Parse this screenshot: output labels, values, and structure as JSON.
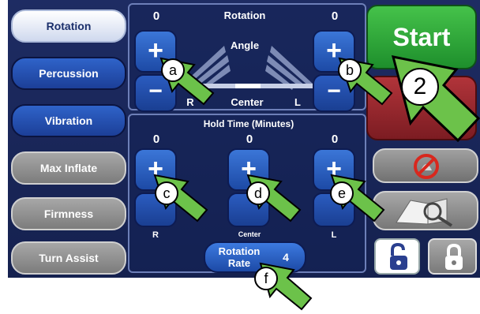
{
  "menu": {
    "rotation": "Rotation",
    "percussion": "Percussion",
    "vibration": "Vibration",
    "max_inflate": "Max Inflate",
    "firmness": "Firmness",
    "turn_assist": "Turn Assist"
  },
  "rotation_panel": {
    "title": "Rotation",
    "subtitle": "Angle",
    "left_value": "0",
    "right_value": "0",
    "center_label": "Center",
    "left_side_label": "R",
    "right_side_label": "L",
    "plus_symbol": "+",
    "minus_symbol": "−"
  },
  "hold_panel": {
    "title": "Hold Time (Minutes)",
    "values": [
      "0",
      "0",
      "0"
    ],
    "labels": [
      "R",
      "Center",
      "L"
    ],
    "plus_symbol": "+"
  },
  "rate": {
    "label_line1": "Rotation",
    "label_line2": "Rate",
    "value": "4"
  },
  "right": {
    "start_label": "Start"
  },
  "callouts": {
    "a": "a",
    "b": "b",
    "c": "c",
    "d": "d",
    "e": "e",
    "f": "f",
    "two": "2"
  },
  "colors": {
    "screen_bg": "#1e2c63",
    "menu_blue": "#2f63c9",
    "menu_gray": "#8f8f8f",
    "start_green": "#2fa83a",
    "stop_red": "#9a2a30",
    "arrow_green": "#6cc24a"
  },
  "icons": {
    "silence": "no-bell-icon",
    "help": "book-magnifier-icon",
    "unlock": "unlocked-padlock-icon",
    "lock": "locked-padlock-icon"
  }
}
